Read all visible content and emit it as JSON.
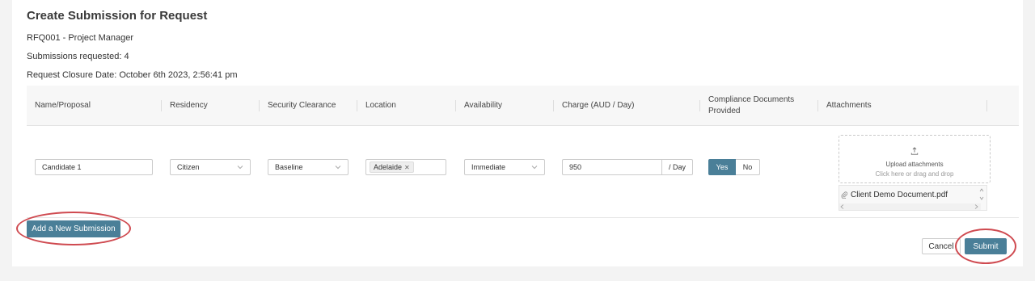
{
  "page": {
    "title": "Create Submission for Request",
    "request_ref": "RFQ001 - Project Manager",
    "submissions_requested": "Submissions requested: 4",
    "closure_date": "Request Closure Date: October 6th 2023, 2:56:41 pm"
  },
  "table": {
    "headers": {
      "name": "Name/Proposal",
      "residency": "Residency",
      "security": "Security Clearance",
      "location": "Location",
      "availability": "Availability",
      "charge": "Charge (AUD / Day)",
      "compliance_1": "Compliance Documents",
      "compliance_2": "Provided",
      "attachments": "Attachments"
    },
    "row": {
      "name": "Candidate 1",
      "residency": "Citizen",
      "security": "Baseline",
      "location_chip": "Adelaide",
      "availability": "Immediate",
      "charge": "950",
      "charge_suffix": "/ Day",
      "compliance_yes": "Yes",
      "compliance_no": "No",
      "upload_title": "Upload attachments",
      "upload_hint": "Click here or drag and drop",
      "file_name": "Client Demo Document.pdf"
    }
  },
  "actions": {
    "add_submission": "Add a New Submission",
    "cancel": "Cancel",
    "submit": "Submit"
  },
  "colors": {
    "primary": "#4a7f98",
    "highlight_circle": "#cf4a50"
  },
  "icons": {
    "upload": "upload-icon",
    "attachment": "paperclip-icon",
    "dropdown": "chevron-down-icon",
    "remove": "close-icon"
  }
}
